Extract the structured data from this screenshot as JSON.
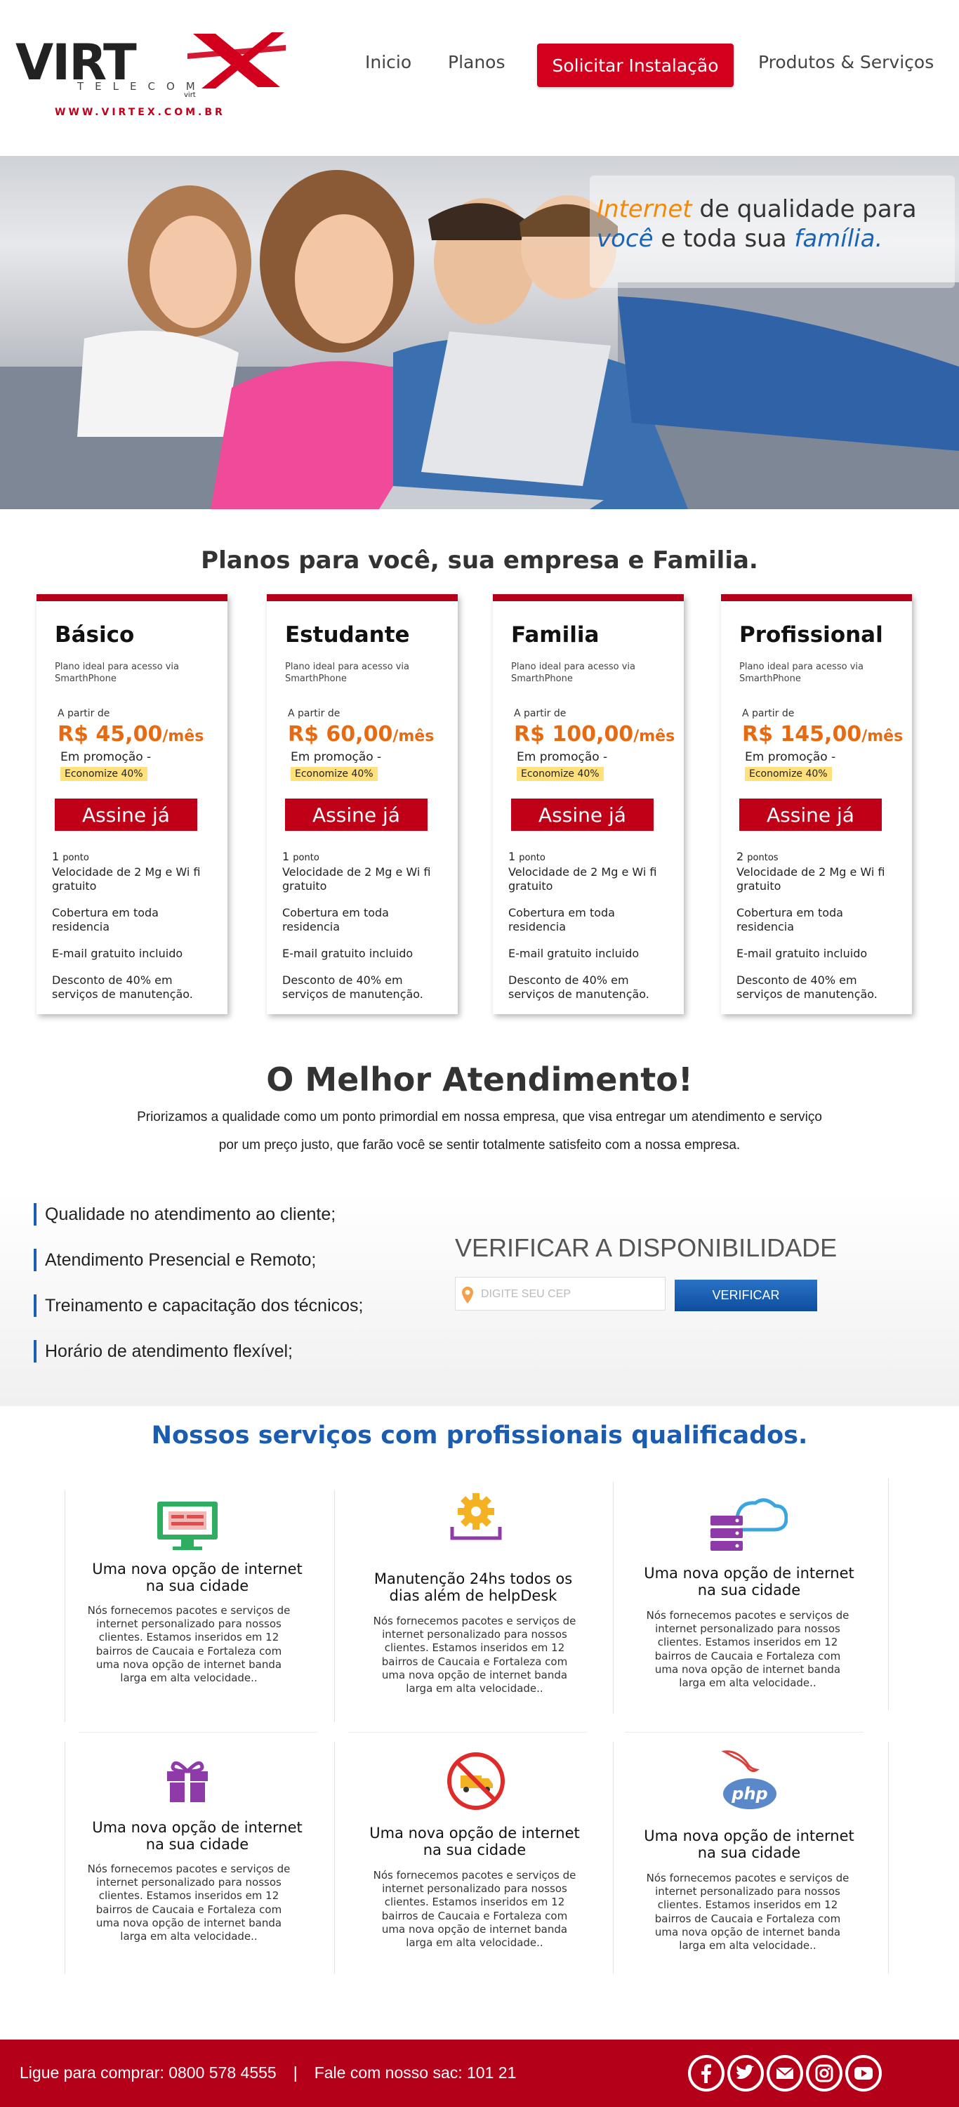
{
  "header": {
    "logo": {
      "brand": "VIRT",
      "x": "X",
      "telecom": "TELECOM",
      "small": "virt",
      "url": "WWW.VIRTEX.COM.BR"
    },
    "nav": {
      "items": [
        "Inicio",
        "Planos"
      ],
      "cta": "Solicitar Instalação",
      "last": "Produtos & Serviços"
    }
  },
  "hero": {
    "line1": {
      "highlight": "Internet",
      "rest": " de qualidade para"
    },
    "line2": {
      "highlight1": "você",
      "mid": " e toda sua ",
      "highlight2": "família."
    }
  },
  "plans": {
    "title": "Planos para você, sua empresa e Familia.",
    "items": [
      {
        "name": "Básico",
        "desc": "Plano ideal para acesso via SmarthPhone",
        "from": "A partir de",
        "price": "R$ 45,00",
        "unit": "/mês",
        "promo": "Em promoção -",
        "badge": "Economize 40%",
        "button": "Assine já",
        "points_num": "1",
        "points_label": "ponto",
        "speed": "Velocidade de 2 Mg e Wi fi gratuito",
        "coverage": "Cobertura em toda residencia",
        "email": "E-mail gratuito incluido",
        "discount": "Desconto de 40% em serviços de manutenção."
      },
      {
        "name": "Estudante",
        "desc": "Plano ideal para acesso via SmarthPhone",
        "from": "A partir de",
        "price": "R$ 60,00",
        "unit": "/mês",
        "promo": "Em promoção -",
        "badge": "Economize 40%",
        "button": "Assine já",
        "points_num": "1",
        "points_label": "ponto",
        "speed": "Velocidade de 2 Mg e Wi fi gratuito",
        "coverage": "Cobertura em toda residencia",
        "email": "E-mail gratuito incluido",
        "discount": "Desconto de 40% em serviços de manutenção."
      },
      {
        "name": "Familia",
        "desc": "Plano ideal para acesso via SmarthPhone",
        "from": "A partir de",
        "price": "R$ 100,00",
        "unit": "/mês",
        "promo": "Em promoção -",
        "badge": "Economize 40%",
        "button": "Assine já",
        "points_num": "1",
        "points_label": "ponto",
        "speed": "Velocidade de 2 Mg e Wi fi gratuito",
        "coverage": "Cobertura em toda residencia",
        "email": "E-mail gratuito incluido",
        "discount": "Desconto de 40% em serviços de manutenção."
      },
      {
        "name": "Profissional",
        "desc": "Plano ideal para acesso via SmarthPhone",
        "from": "A partir de",
        "price": "R$ 145,00",
        "unit": "/mês",
        "promo": "Em promoção -",
        "badge": "Economize 40%",
        "button": "Assine já",
        "points_num": "2",
        "points_label": "pontos",
        "speed": "Velocidade de 2 Mg e Wi fi gratuito",
        "coverage": "Cobertura em toda residencia",
        "email": "E-mail gratuito incluido",
        "discount": "Desconto de 40% em serviços de manutenção."
      }
    ]
  },
  "attendance": {
    "title": "O Melhor Atendimento!",
    "sub1": "Priorizamos a qualidade como um ponto primordial em nossa empresa, que visa entregar um atendimento e serviço",
    "sub2": "por um preço justo,  que farão você se sentir totalmente satisfeito com a nossa empresa.",
    "list": [
      "Qualidade no atendimento ao cliente;",
      "Atendimento Presencial e Remoto;",
      "Treinamento e capacitação dos técnicos;",
      "Horário de atendimento flexível;"
    ],
    "verify": {
      "title": "VERIFICAR A DISPONIBILIDADE",
      "placeholder": "DIGITE SEU CEP",
      "button": "VERIFICAR"
    }
  },
  "services": {
    "title": "Nossos serviços com profissionais qualificados.",
    "items": [
      {
        "icon": "monitor-icon",
        "heading": "Uma nova opção de internet na sua cidade",
        "body": "Nós fornecemos pacotes e serviços de internet personalizado para nossos clientes. Estamos inseridos em 12 bairros de Caucaia e Fortaleza com uma nova opção de internet banda larga em alta velocidade.."
      },
      {
        "icon": "gear-icon",
        "heading": "Manutenção 24hs todos os dias além de helpDesk",
        "body": "Nós fornecemos pacotes e serviços de internet personalizado para nossos clientes. Estamos inseridos em 12 bairros de Caucaia e Fortaleza com uma nova opção de internet banda larga em alta velocidade.."
      },
      {
        "icon": "server-cloud-icon",
        "heading": "Uma nova opção de internet na sua cidade",
        "body": "Nós fornecemos pacotes e serviços de internet personalizado para nossos clientes. Estamos inseridos em 12 bairros de Caucaia e Fortaleza com uma nova opção de internet banda larga em alta velocidade.."
      },
      {
        "icon": "gift-icon",
        "heading": "Uma nova opção de internet na sua cidade",
        "body": "Nós fornecemos pacotes e serviços de internet personalizado para nossos clientes. Estamos inseridos em 12 bairros de Caucaia e Fortaleza com uma nova opção de internet banda larga em alta velocidade.."
      },
      {
        "icon": "no-truck-icon",
        "heading": "Uma nova opção de internet na sua cidade",
        "body": "Nós fornecemos pacotes e serviços de internet personalizado para nossos clientes. Estamos inseridos em 12 bairros de Caucaia e Fortaleza com uma nova opção de internet banda larga em alta velocidade.."
      },
      {
        "icon": "php-mysql-icon",
        "heading": "Uma nova opção de internet na sua cidade",
        "body": "Nós fornecemos pacotes e serviços de internet personalizado para nossos clientes. Estamos inseridos em 12 bairros de Caucaia e Fortaleza com uma nova opção de internet banda larga em alta velocidade.."
      }
    ]
  },
  "footer": {
    "buy": "Ligue para comprar: 0800 578 4555",
    "separator": "|",
    "sac": "Fale com nosso sac: 101 21",
    "social": [
      "facebook-icon",
      "twitter-icon",
      "email-icon",
      "instagram-icon",
      "youtube-icon"
    ]
  },
  "colors": {
    "brand_red": "#b5001a",
    "accent_orange": "#e86a10",
    "accent_blue": "#1a5cb0",
    "badge_yellow": "#ffe07a"
  }
}
